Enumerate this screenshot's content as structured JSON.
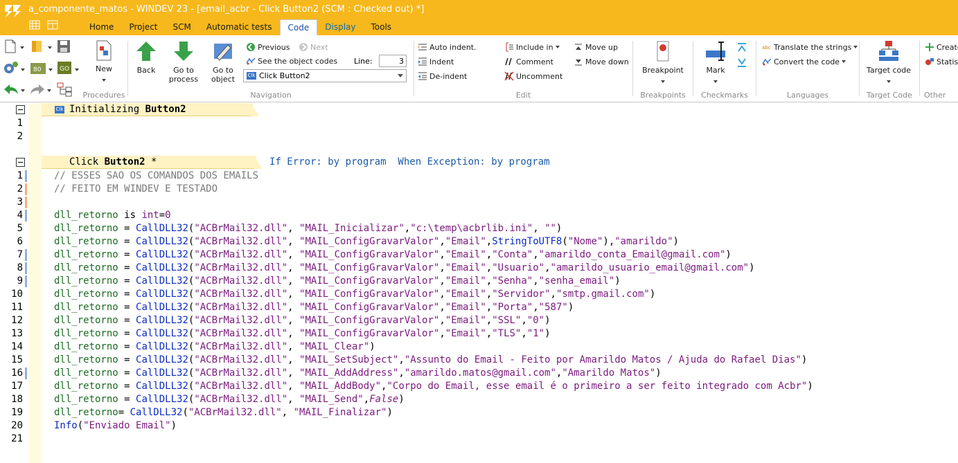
{
  "window": {
    "title": "a_componente_matos - WINDEV 23 - [email_acbr - Click Button2 (SCM : Checked out) *]"
  },
  "menu_tabs": [
    {
      "label": "Home"
    },
    {
      "label": "Project"
    },
    {
      "label": "SCM"
    },
    {
      "label": "Automatic tests"
    },
    {
      "label": "Code",
      "active": true
    },
    {
      "label": "Display"
    },
    {
      "label": "Tools"
    }
  ],
  "ribbon": {
    "procedures": {
      "label": "Procedures",
      "new_label": "New"
    },
    "navigation": {
      "label": "Navigation",
      "back": "Back",
      "goto_process_1": "Go to",
      "goto_process_2": "process",
      "goto_object_1": "Go to",
      "goto_object_2": "object",
      "previous": "Previous",
      "next": "Next",
      "see_object_codes": "See the object codes",
      "line_label": "Line:",
      "line_value": "3",
      "combo_value": "Click Button2"
    },
    "edit": {
      "label": "Edit",
      "auto_indent": "Auto indent.",
      "indent": "Indent",
      "de_indent": "De-indent",
      "include_in": "Include in",
      "comment": "Comment",
      "uncomment": "Uncomment",
      "move_up": "Move up",
      "move_down": "Move down"
    },
    "breakpoints": {
      "label": "Breakpoints",
      "button": "Breakpoint"
    },
    "checkmarks": {
      "label": "Checkmarks",
      "button": "Mark"
    },
    "languages": {
      "label": "Languages",
      "translate": "Translate the strings",
      "convert": "Convert the code"
    },
    "target_code": {
      "label": "Target Code",
      "button": "Target code"
    },
    "other": {
      "label": "Other",
      "create": "Create",
      "statistics": "Statisti"
    }
  },
  "editor": {
    "init_section": {
      "icon_text": "Clk",
      "title_prefix": "Initializing ",
      "title_bold": "Button2",
      "lines": [
        "1",
        "2"
      ]
    },
    "click_section": {
      "title_prefix": "Click ",
      "title_bold": "Button2",
      "title_suffix": " *",
      "exception_text": "If Error: by program  When Exception: by program"
    },
    "code_lines": [
      {
        "n": "1",
        "mark": "#8fb0e0",
        "tokens": [
          {
            "t": "// ESSES SAO OS COMANDOS DOS EMAILS",
            "c": "cm"
          }
        ]
      },
      {
        "n": "2",
        "mark": "#f3b07a",
        "tokens": [
          {
            "t": "// FEITO EM WINDEV E TESTADO",
            "c": "cm"
          }
        ]
      },
      {
        "n": "3",
        "mark": "#f3b07a",
        "tokens": []
      },
      {
        "n": "4",
        "mark": "#8fb0e0",
        "tokens": [
          {
            "t": "dll_retorno",
            "c": "var"
          },
          {
            "t": " is ",
            "c": "kw"
          },
          {
            "t": "int",
            "c": "str"
          },
          {
            "t": "=",
            "c": "kw"
          },
          {
            "t": "0",
            "c": "num"
          }
        ]
      },
      {
        "n": "5",
        "mark": "",
        "tokens": [
          {
            "t": "dll_retorno",
            "c": "var"
          },
          {
            "t": " = ",
            "c": "kw"
          },
          {
            "t": "CallDLL32",
            "c": "fn"
          },
          {
            "t": "(",
            "c": "kw"
          },
          {
            "t": "\"ACBrMail32.dll\"",
            "c": "str"
          },
          {
            "t": ", ",
            "c": "kw"
          },
          {
            "t": "\"MAIL_Inicializar\"",
            "c": "str"
          },
          {
            "t": ",",
            "c": "kw"
          },
          {
            "t": "\"c:\\temp\\acbrlib.ini\"",
            "c": "str"
          },
          {
            "t": ", ",
            "c": "kw"
          },
          {
            "t": "\"\"",
            "c": "str"
          },
          {
            "t": ")",
            "c": "kw"
          }
        ]
      },
      {
        "n": "6",
        "mark": "",
        "tokens": [
          {
            "t": "dll_retorno",
            "c": "var"
          },
          {
            "t": " = ",
            "c": "kw"
          },
          {
            "t": "CallDLL32",
            "c": "fn"
          },
          {
            "t": "(",
            "c": "kw"
          },
          {
            "t": "\"ACBrMail32.dll\"",
            "c": "str"
          },
          {
            "t": ", ",
            "c": "kw"
          },
          {
            "t": "\"MAIL_ConfigGravarValor\"",
            "c": "str"
          },
          {
            "t": ",",
            "c": "kw"
          },
          {
            "t": "\"Email\"",
            "c": "str"
          },
          {
            "t": ",",
            "c": "kw"
          },
          {
            "t": "StringToUTF8",
            "c": "fn"
          },
          {
            "t": "(",
            "c": "kw"
          },
          {
            "t": "\"Nome\"",
            "c": "str"
          },
          {
            "t": "),",
            "c": "kw"
          },
          {
            "t": "\"amarildo\"",
            "c": "str"
          },
          {
            "t": ")",
            "c": "kw"
          }
        ]
      },
      {
        "n": "7",
        "mark": "#8fb0e0",
        "tokens": [
          {
            "t": "dll_retorno",
            "c": "var"
          },
          {
            "t": " = ",
            "c": "kw"
          },
          {
            "t": "CallDLL32",
            "c": "fn"
          },
          {
            "t": "(",
            "c": "kw"
          },
          {
            "t": "\"ACBrMail32.dll\"",
            "c": "str"
          },
          {
            "t": ", ",
            "c": "kw"
          },
          {
            "t": "\"MAIL_ConfigGravarValor\"",
            "c": "str"
          },
          {
            "t": ",",
            "c": "kw"
          },
          {
            "t": "\"Email\"",
            "c": "str"
          },
          {
            "t": ",",
            "c": "kw"
          },
          {
            "t": "\"Conta\"",
            "c": "str"
          },
          {
            "t": ",",
            "c": "kw"
          },
          {
            "t": "\"amarildo_conta_Email@gmail.com\"",
            "c": "str"
          },
          {
            "t": ")",
            "c": "kw"
          }
        ]
      },
      {
        "n": "8",
        "mark": "#8fb0e0",
        "tokens": [
          {
            "t": "dll_retorno",
            "c": "var"
          },
          {
            "t": " = ",
            "c": "kw"
          },
          {
            "t": "CallDLL32",
            "c": "fn"
          },
          {
            "t": "(",
            "c": "kw"
          },
          {
            "t": "\"ACBrMail32.dll\"",
            "c": "str"
          },
          {
            "t": ", ",
            "c": "kw"
          },
          {
            "t": "\"MAIL_ConfigGravarValor\"",
            "c": "str"
          },
          {
            "t": ",",
            "c": "kw"
          },
          {
            "t": "\"Email\"",
            "c": "str"
          },
          {
            "t": ",",
            "c": "kw"
          },
          {
            "t": "\"Usuario\"",
            "c": "str"
          },
          {
            "t": ",",
            "c": "kw"
          },
          {
            "t": "\"amarildo_usuario_email@gmail.com\"",
            "c": "str"
          },
          {
            "t": ")",
            "c": "kw"
          }
        ]
      },
      {
        "n": "9",
        "mark": "#8fb0e0",
        "tokens": [
          {
            "t": "dll_retorno",
            "c": "var"
          },
          {
            "t": " = ",
            "c": "kw"
          },
          {
            "t": "CallDLL32",
            "c": "fn"
          },
          {
            "t": "(",
            "c": "kw"
          },
          {
            "t": "\"ACBrMail32.dll\"",
            "c": "str"
          },
          {
            "t": ", ",
            "c": "kw"
          },
          {
            "t": "\"MAIL_ConfigGravarValor\"",
            "c": "str"
          },
          {
            "t": ",",
            "c": "kw"
          },
          {
            "t": "\"Email\"",
            "c": "str"
          },
          {
            "t": ",",
            "c": "kw"
          },
          {
            "t": "\"Senha\"",
            "c": "str"
          },
          {
            "t": ",",
            "c": "kw"
          },
          {
            "t": "\"senha_email\"",
            "c": "str"
          },
          {
            "t": ")",
            "c": "kw"
          }
        ]
      },
      {
        "n": "10",
        "mark": "",
        "tokens": [
          {
            "t": "dll_retorno",
            "c": "var"
          },
          {
            "t": " = ",
            "c": "kw"
          },
          {
            "t": "CallDLL32",
            "c": "fn"
          },
          {
            "t": "(",
            "c": "kw"
          },
          {
            "t": "\"ACBrMail32.dll\"",
            "c": "str"
          },
          {
            "t": ", ",
            "c": "kw"
          },
          {
            "t": "\"MAIL_ConfigGravarValor\"",
            "c": "str"
          },
          {
            "t": ",",
            "c": "kw"
          },
          {
            "t": "\"Email\"",
            "c": "str"
          },
          {
            "t": ",",
            "c": "kw"
          },
          {
            "t": "\"Servidor\"",
            "c": "str"
          },
          {
            "t": ",",
            "c": "kw"
          },
          {
            "t": "\"smtp.gmail.com\"",
            "c": "str"
          },
          {
            "t": ")",
            "c": "kw"
          }
        ]
      },
      {
        "n": "11",
        "mark": "",
        "tokens": [
          {
            "t": "dll_retorno",
            "c": "var"
          },
          {
            "t": " = ",
            "c": "kw"
          },
          {
            "t": "CallDLL32",
            "c": "fn"
          },
          {
            "t": "(",
            "c": "kw"
          },
          {
            "t": "\"ACBrMail32.dll\"",
            "c": "str"
          },
          {
            "t": ", ",
            "c": "kw"
          },
          {
            "t": "\"MAIL_ConfigGravarValor\"",
            "c": "str"
          },
          {
            "t": ",",
            "c": "kw"
          },
          {
            "t": "\"Email\"",
            "c": "str"
          },
          {
            "t": ",",
            "c": "kw"
          },
          {
            "t": "\"Porta\"",
            "c": "str"
          },
          {
            "t": ",",
            "c": "kw"
          },
          {
            "t": "\"587\"",
            "c": "str"
          },
          {
            "t": ")",
            "c": "kw"
          }
        ]
      },
      {
        "n": "12",
        "mark": "",
        "tokens": [
          {
            "t": "dll_retorno",
            "c": "var"
          },
          {
            "t": " = ",
            "c": "kw"
          },
          {
            "t": "CallDLL32",
            "c": "fn"
          },
          {
            "t": "(",
            "c": "kw"
          },
          {
            "t": "\"ACBrMail32.dll\"",
            "c": "str"
          },
          {
            "t": ", ",
            "c": "kw"
          },
          {
            "t": "\"MAIL_ConfigGravarValor\"",
            "c": "str"
          },
          {
            "t": ",",
            "c": "kw"
          },
          {
            "t": "\"Email\"",
            "c": "str"
          },
          {
            "t": ",",
            "c": "kw"
          },
          {
            "t": "\"SSL\"",
            "c": "str"
          },
          {
            "t": ",",
            "c": "kw"
          },
          {
            "t": "\"0\"",
            "c": "str"
          },
          {
            "t": ")",
            "c": "kw"
          }
        ]
      },
      {
        "n": "13",
        "mark": "",
        "tokens": [
          {
            "t": "dll_retorno",
            "c": "var"
          },
          {
            "t": " = ",
            "c": "kw"
          },
          {
            "t": "CallDLL32",
            "c": "fn"
          },
          {
            "t": "(",
            "c": "kw"
          },
          {
            "t": "\"ACBrMail32.dll\"",
            "c": "str"
          },
          {
            "t": ", ",
            "c": "kw"
          },
          {
            "t": "\"MAIL_ConfigGravarValor\"",
            "c": "str"
          },
          {
            "t": ",",
            "c": "kw"
          },
          {
            "t": "\"Email\"",
            "c": "str"
          },
          {
            "t": ",",
            "c": "kw"
          },
          {
            "t": "\"TLS\"",
            "c": "str"
          },
          {
            "t": ",",
            "c": "kw"
          },
          {
            "t": "\"1\"",
            "c": "str"
          },
          {
            "t": ")",
            "c": "kw"
          }
        ]
      },
      {
        "n": "14",
        "mark": "",
        "tokens": [
          {
            "t": "dll_retorno",
            "c": "var"
          },
          {
            "t": " = ",
            "c": "kw"
          },
          {
            "t": "CallDLL32",
            "c": "fn"
          },
          {
            "t": "(",
            "c": "kw"
          },
          {
            "t": "\"ACBrMail32.dll\"",
            "c": "str"
          },
          {
            "t": ", ",
            "c": "kw"
          },
          {
            "t": "\"MAIL_Clear\"",
            "c": "str"
          },
          {
            "t": ")",
            "c": "kw"
          }
        ]
      },
      {
        "n": "15",
        "mark": "",
        "tokens": [
          {
            "t": "dll_retorno",
            "c": "var"
          },
          {
            "t": " = ",
            "c": "kw"
          },
          {
            "t": "CallDLL32",
            "c": "fn"
          },
          {
            "t": "(",
            "c": "kw"
          },
          {
            "t": "\"ACBrMail32.dll\"",
            "c": "str"
          },
          {
            "t": ", ",
            "c": "kw"
          },
          {
            "t": "\"MAIL_SetSubject\"",
            "c": "str"
          },
          {
            "t": ",",
            "c": "kw"
          },
          {
            "t": "\"Assunto do Email - Feito por Amarildo Matos / Ajuda do Rafael Dias\"",
            "c": "str"
          },
          {
            "t": ")",
            "c": "kw"
          }
        ]
      },
      {
        "n": "16",
        "mark": "#8fb0e0",
        "tokens": [
          {
            "t": "dll_retorno",
            "c": "var"
          },
          {
            "t": " = ",
            "c": "kw"
          },
          {
            "t": "CallDLL32",
            "c": "fn"
          },
          {
            "t": "(",
            "c": "kw"
          },
          {
            "t": "\"ACBrMail32.dll\"",
            "c": "str"
          },
          {
            "t": ", ",
            "c": "kw"
          },
          {
            "t": "\"MAIL_AddAddress\"",
            "c": "str"
          },
          {
            "t": ",",
            "c": "kw"
          },
          {
            "t": "\"amarildo.matos@gmail.com\"",
            "c": "str"
          },
          {
            "t": ",",
            "c": "kw"
          },
          {
            "t": "\"Amarildo Matos\"",
            "c": "str"
          },
          {
            "t": ")",
            "c": "kw"
          }
        ]
      },
      {
        "n": "17",
        "mark": "",
        "tokens": [
          {
            "t": "dll_retorno",
            "c": "var"
          },
          {
            "t": " = ",
            "c": "kw"
          },
          {
            "t": "CallDLL32",
            "c": "fn"
          },
          {
            "t": "(",
            "c": "kw"
          },
          {
            "t": "\"ACBrMail32.dll\"",
            "c": "str"
          },
          {
            "t": ", ",
            "c": "kw"
          },
          {
            "t": "\"MAIL_AddBody\"",
            "c": "str"
          },
          {
            "t": ",",
            "c": "kw"
          },
          {
            "t": "\"Corpo do Email, esse email é o primeiro a ser feito integrado com Acbr\"",
            "c": "str"
          },
          {
            "t": ")",
            "c": "kw"
          }
        ]
      },
      {
        "n": "18",
        "mark": "",
        "tokens": [
          {
            "t": "dll_retorno",
            "c": "var"
          },
          {
            "t": " = ",
            "c": "kw"
          },
          {
            "t": "CallDLL32",
            "c": "fn"
          },
          {
            "t": "(",
            "c": "kw"
          },
          {
            "t": "\"ACBrMail32.dll\"",
            "c": "str"
          },
          {
            "t": ", ",
            "c": "kw"
          },
          {
            "t": "\"MAIL_Send\"",
            "c": "str"
          },
          {
            "t": ",",
            "c": "kw"
          },
          {
            "t": "False",
            "c": "it"
          },
          {
            "t": ")",
            "c": "kw"
          }
        ]
      },
      {
        "n": "19",
        "mark": "",
        "tokens": [
          {
            "t": "dll_retorno",
            "c": "var"
          },
          {
            "t": "= ",
            "c": "kw"
          },
          {
            "t": "CallDLL32",
            "c": "fn"
          },
          {
            "t": "(",
            "c": "kw"
          },
          {
            "t": "\"ACBrMail32.dll\"",
            "c": "str"
          },
          {
            "t": ", ",
            "c": "kw"
          },
          {
            "t": "\"MAIL_Finalizar\"",
            "c": "str"
          },
          {
            "t": ")",
            "c": "kw"
          }
        ]
      },
      {
        "n": "20",
        "mark": "",
        "tokens": [
          {
            "t": "Info",
            "c": "fn"
          },
          {
            "t": "(",
            "c": "kw"
          },
          {
            "t": "\"Enviado Email\"",
            "c": "str"
          },
          {
            "t": ")",
            "c": "kw"
          }
        ]
      },
      {
        "n": "21",
        "mark": "",
        "tokens": []
      }
    ]
  },
  "colors": {
    "titlebar": "#f6b81c",
    "header_band": "#fff3c4",
    "function": "#0b2bc4",
    "string": "#7b1b7e",
    "variable": "#1d6b22",
    "comment": "#7a7a7a"
  }
}
